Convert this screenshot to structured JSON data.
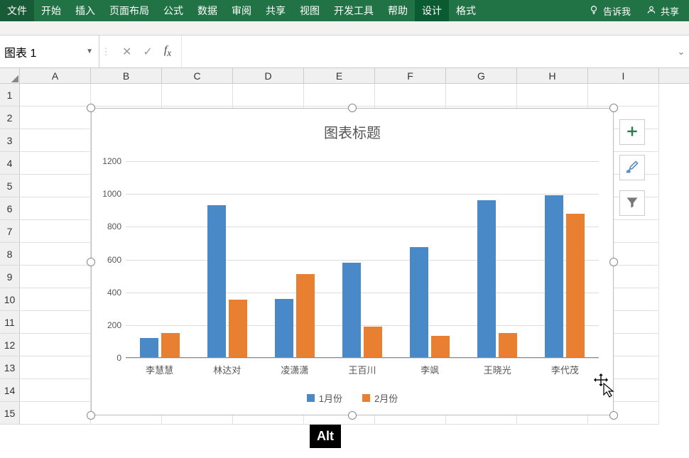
{
  "ribbon": {
    "tabs": [
      "文件",
      "开始",
      "插入",
      "页面布局",
      "公式",
      "数据",
      "审阅",
      "共享",
      "视图",
      "开发工具",
      "帮助",
      "设计",
      "格式"
    ],
    "tell_me": "告诉我",
    "share": "共享"
  },
  "formula_bar": {
    "name_box": "图表 1",
    "formula": ""
  },
  "grid": {
    "columns": [
      "A",
      "B",
      "C",
      "D",
      "E",
      "F",
      "G",
      "H",
      "I"
    ],
    "rows": [
      "1",
      "2",
      "3",
      "4",
      "5",
      "6",
      "7",
      "8",
      "9",
      "10",
      "11",
      "12",
      "13",
      "14",
      "15"
    ]
  },
  "alt_key": "Alt",
  "chart_data": {
    "type": "bar",
    "title": "图表标题",
    "categories": [
      "李慧慧",
      "林达对",
      "凌潇潇",
      "王百川",
      "李飒",
      "王晓光",
      "李代茂"
    ],
    "series": [
      {
        "name": "1月份",
        "values": [
          120,
          930,
          360,
          580,
          675,
          960,
          990
        ],
        "color": "#4a89c7"
      },
      {
        "name": "2月份",
        "values": [
          150,
          355,
          510,
          190,
          135,
          150,
          880
        ],
        "color": "#e87f31"
      }
    ],
    "ylim": [
      0,
      1200
    ],
    "y_ticks": [
      0,
      200,
      400,
      600,
      800,
      1000,
      1200
    ]
  }
}
